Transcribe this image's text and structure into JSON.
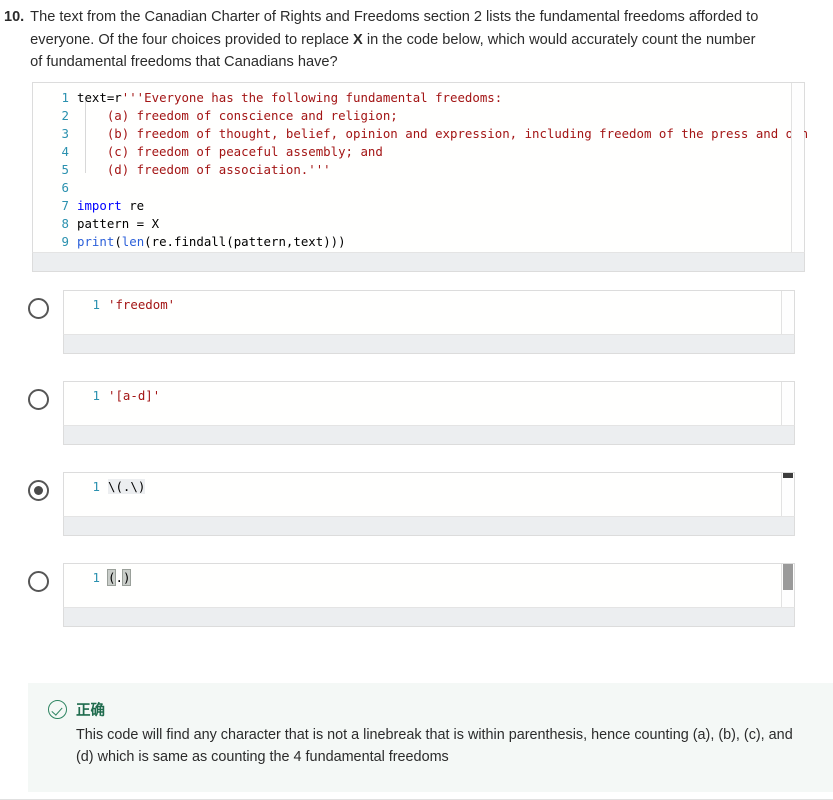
{
  "question": {
    "number": "10.",
    "text_before_x": "The text from the Canadian Charter of Rights and Freedoms section 2 lists the fundamental freedoms afforded to everyone. Of the four choices provided to replace ",
    "x_token": "X",
    "text_after_x": " in the code below, which would accurately count the number of fundamental freedoms that Canadians have?"
  },
  "main_code": {
    "lines": [
      {
        "num": "1",
        "segments": [
          {
            "text": "text=r",
            "cls": "s-pl"
          },
          {
            "text": "'''Everyone has the following fundamental freedoms:",
            "cls": "s-str"
          }
        ]
      },
      {
        "num": "2",
        "segments": [
          {
            "text": "    (a) freedom of conscience and religion;",
            "cls": "s-str"
          }
        ]
      },
      {
        "num": "3",
        "segments": [
          {
            "text": "    (b) freedom of thought, belief, opinion and expression, including freedom of the press and oth",
            "cls": "s-str"
          }
        ]
      },
      {
        "num": "4",
        "segments": [
          {
            "text": "    (c) freedom of peaceful assembly; and",
            "cls": "s-str"
          }
        ]
      },
      {
        "num": "5",
        "segments": [
          {
            "text": "    (d) freedom of association.'''",
            "cls": "s-str"
          }
        ]
      },
      {
        "num": "6",
        "segments": [
          {
            "text": "",
            "cls": "s-pl"
          }
        ]
      },
      {
        "num": "7",
        "segments": [
          {
            "text": "import",
            "cls": "s-kw"
          },
          {
            "text": " re",
            "cls": "s-pl"
          }
        ]
      },
      {
        "num": "8",
        "segments": [
          {
            "text": "pattern = X",
            "cls": "s-pl"
          }
        ]
      },
      {
        "num": "9",
        "segments": [
          {
            "text": "print",
            "cls": "s-fn"
          },
          {
            "text": "(",
            "cls": "s-pl"
          },
          {
            "text": "len",
            "cls": "s-fn"
          },
          {
            "text": "(re.findall(pattern,text)))",
            "cls": "s-pl"
          }
        ]
      }
    ]
  },
  "options": [
    {
      "id": "option-a",
      "selected": false,
      "line_number": "1",
      "segments": [
        {
          "text": "'freedom'",
          "cls": "s-str"
        }
      ],
      "scrollbar": "none"
    },
    {
      "id": "option-b",
      "selected": false,
      "line_number": "1",
      "segments": [
        {
          "text": "'[a-d]'",
          "cls": "s-str"
        }
      ],
      "scrollbar": "none"
    },
    {
      "id": "option-c",
      "selected": true,
      "line_number": "1",
      "segments": [
        {
          "text": "\\(.\\)",
          "cls": "s-pl sel-hl"
        }
      ],
      "scrollbar": "dark"
    },
    {
      "id": "option-d",
      "selected": false,
      "line_number": "1",
      "segments": [
        {
          "text": "(",
          "cls": "s-pl brk"
        },
        {
          "text": ".",
          "cls": "s-pl"
        },
        {
          "text": ")",
          "cls": "s-pl brk"
        }
      ],
      "scrollbar": "gray"
    }
  ],
  "feedback": {
    "icon": "check-circle-icon",
    "title": "正确",
    "body": "This code will find any character that is not a linebreak that is within parenthesis, hence counting (a), (b), (c), and (d) which is same as counting the 4 fundamental freedoms"
  },
  "colors": {
    "string": "#a31515",
    "keyword": "#0000ff",
    "function": "#2b5fd9",
    "line_number": "#2b91af",
    "feedback_green": "#2e8562",
    "feedback_bg": "#f4f8f6"
  }
}
